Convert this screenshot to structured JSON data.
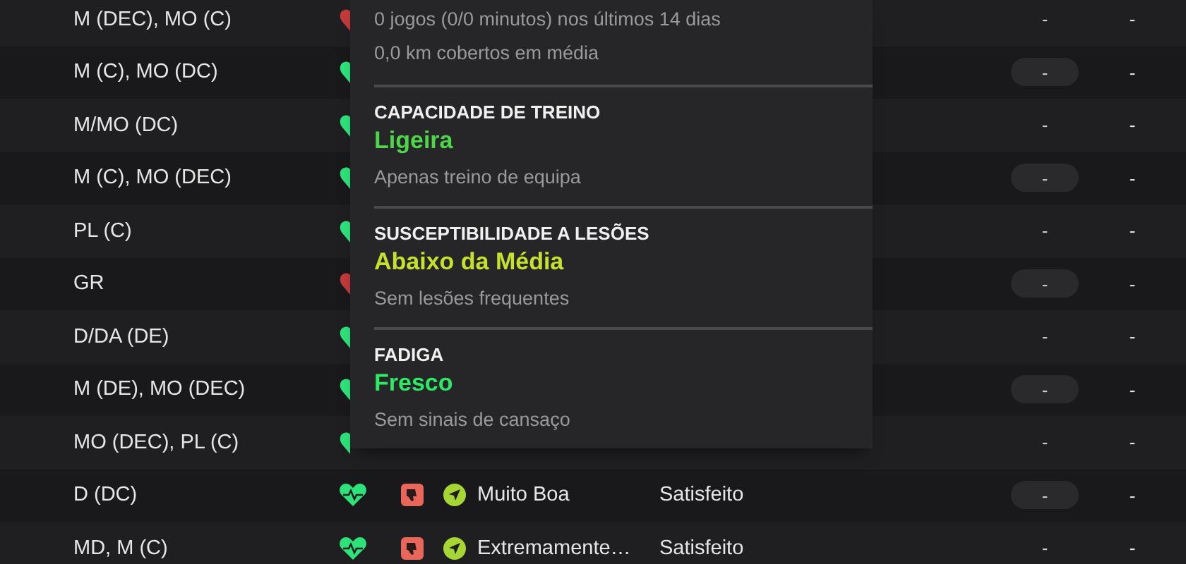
{
  "rows": [
    {
      "position": "M (DEC), MO (C)",
      "color": "#c23a3a"
    },
    {
      "position": "M (C), MO (DC)",
      "color": "#2ee27a"
    },
    {
      "position": "M/MO (DC)",
      "color": "#2ee27a"
    },
    {
      "position": "M (C), MO (DEC)",
      "color": "#2ee27a"
    },
    {
      "position": "PL (C)",
      "color": "#2ee27a"
    },
    {
      "position": "GR",
      "color": "#c23a3a"
    },
    {
      "position": "D/DA (DE)",
      "color": "#2ee27a"
    },
    {
      "position": "M (DE), MO (DEC)",
      "color": "#2ee27a"
    },
    {
      "position": "MO (DEC), PL (C)",
      "color": "#2ee27a"
    },
    {
      "position": "D (DC)",
      "color": "#2ee27a",
      "morale": "Muito Boa",
      "status": "Satisfeito"
    },
    {
      "position": "MD, M (C)",
      "color": "#2ee27a",
      "morale": "Extremamente…",
      "status": "Satisfeito"
    }
  ],
  "dash_column_1": [
    "-",
    "-",
    "-",
    "-",
    "-",
    "-",
    "-",
    "-",
    "-",
    "-",
    "-"
  ],
  "dash_column_2": [
    "-",
    "-",
    "-",
    "-",
    "-",
    "-",
    "-",
    "-",
    "-",
    "-",
    "-"
  ],
  "tooltip": {
    "match_lines": [
      "0 jogos (0/0 minutos) nos últimos 14 dias",
      "0,0 km cobertos em média"
    ],
    "sections": [
      {
        "title": "CAPACIDADE DE TREINO",
        "value": "Ligeira",
        "color": "#4ed64a",
        "description": "Apenas treino de equipa"
      },
      {
        "title": "SUSCEPTIBILIDADE A LESÕES",
        "value": "Abaixo da Média",
        "color": "#c6e02e",
        "description": "Sem lesões frequentes"
      },
      {
        "title": "FADIGA",
        "value": "Fresco",
        "color": "#2ee866",
        "description": "Sem sinais de cansaço"
      }
    ]
  }
}
